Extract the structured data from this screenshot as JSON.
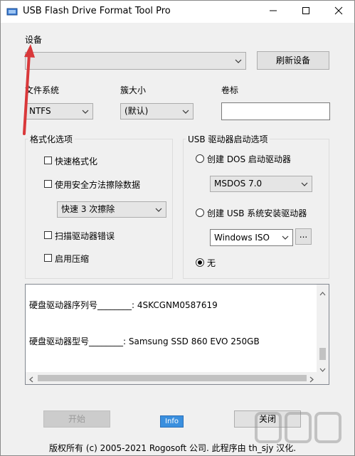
{
  "window": {
    "title": "USB Flash Drive Format Tool Pro",
    "minimize_icon": "minimize-icon",
    "maximize_icon": "maximize-icon",
    "close_icon": "close-icon"
  },
  "device": {
    "label": "设备",
    "selected": "",
    "refresh_label": "刷新设备"
  },
  "filesystem": {
    "label": "文件系统",
    "selected": "NTFS"
  },
  "cluster": {
    "label": "簇大小",
    "selected": "(默认)"
  },
  "volume": {
    "label": "卷标",
    "value": ""
  },
  "format_options": {
    "title": "格式化选项",
    "quick_format": "快速格式化",
    "secure_erase": "使用安全方法擦除数据",
    "erase_passes": "快速 3 次擦除",
    "scan_errors": "扫描驱动器错误",
    "compression": "启用压缩"
  },
  "boot_options": {
    "title": "USB 驱动器启动选项",
    "dos_label": "创建 DOS 启动驱动器",
    "dos_version": "MSDOS 7.0",
    "usb_install_label": "创建 USB 系统安装驱动器",
    "iso_selected": "Windows ISO",
    "browse_label": "...",
    "none_label": "无"
  },
  "info": {
    "serial_line": "硬盘驱动器序列号________: 4SKCGNM0587619",
    "model_line": "硬盘驱动器型号________: Samsung SSD 860 EVO 250GB"
  },
  "buttons": {
    "start": "开始",
    "info": "Info",
    "close": "关闭"
  },
  "footer": {
    "copyright": "版权所有 (c) 2005-2021 Rogosoft 公司.   此程序由 th_sjy 汉化."
  },
  "colors": {
    "accent": "#3a8fde",
    "annotation_arrow": "#d9383a"
  }
}
